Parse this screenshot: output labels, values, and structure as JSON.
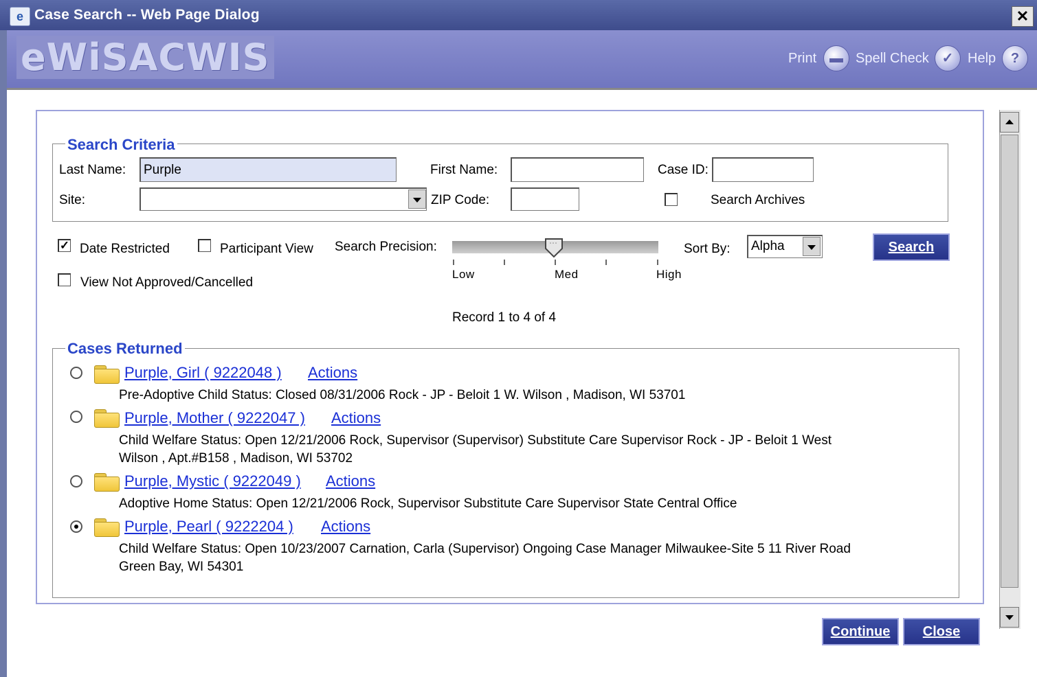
{
  "window": {
    "title": "Case Search -- Web Page Dialog",
    "close_glyph": "✕"
  },
  "header": {
    "logo": "eWiSACWIS",
    "print": "Print",
    "spell_check": "Spell Check",
    "help": "Help"
  },
  "search_criteria": {
    "legend": "Search Criteria",
    "last_name_label": "Last Name:",
    "last_name_value": "Purple",
    "first_name_label": "First Name:",
    "first_name_value": "",
    "case_id_label": "Case ID:",
    "case_id_value": "",
    "site_label": "Site:",
    "site_value": "",
    "zip_label": "ZIP Code:",
    "zip_value": "",
    "search_archives_label": "Search Archives",
    "search_archives_checked": false
  },
  "options": {
    "date_restricted_label": "Date Restricted",
    "date_restricted_checked": true,
    "participant_view_label": "Participant View",
    "participant_view_checked": false,
    "view_not_approved_label": "View Not Approved/Cancelled",
    "view_not_approved_checked": false,
    "precision_label": "Search Precision:",
    "precision_low": "Low",
    "precision_med": "Med",
    "precision_high": "High",
    "precision_value": "Med",
    "sort_by_label": "Sort By:",
    "sort_by_value": "Alpha",
    "search_button": "Search"
  },
  "record_count": "Record 1 to 4 of 4",
  "cases": {
    "legend": "Cases Returned",
    "actions_label": "Actions",
    "items": [
      {
        "name": "Purple, Girl ( 9222048 )",
        "selected": false,
        "line1": "Pre-Adoptive Child   Status: Closed   08/31/2006   Rock - JP - Beloit   1 W. Wilson , Madison,  WI 53701",
        "line2": ""
      },
      {
        "name": "Purple, Mother ( 9222047 )",
        "selected": false,
        "line1": "Child Welfare   Status: Open   12/21/2006   Rock, Supervisor (Supervisor)   Substitute Care Supervisor   Rock - JP - Beloit   1 West",
        "line2": "Wilson , Apt.#B158 , Madison,  WI 53702"
      },
      {
        "name": "Purple, Mystic ( 9222049 )",
        "selected": false,
        "line1": "Adoptive Home   Status: Open   12/21/2006   Rock, Supervisor   Substitute Care Supervisor   State Central Office",
        "line2": ""
      },
      {
        "name": "Purple, Pearl ( 9222204 )",
        "selected": true,
        "line1": "Child Welfare   Status: Open   10/23/2007   Carnation, Carla (Supervisor)   Ongoing Case Manager   Milwaukee-Site 5   11 River Road",
        "line2": "Green Bay,  WI 54301"
      }
    ]
  },
  "footer": {
    "continue": "Continue",
    "close": "Close"
  }
}
